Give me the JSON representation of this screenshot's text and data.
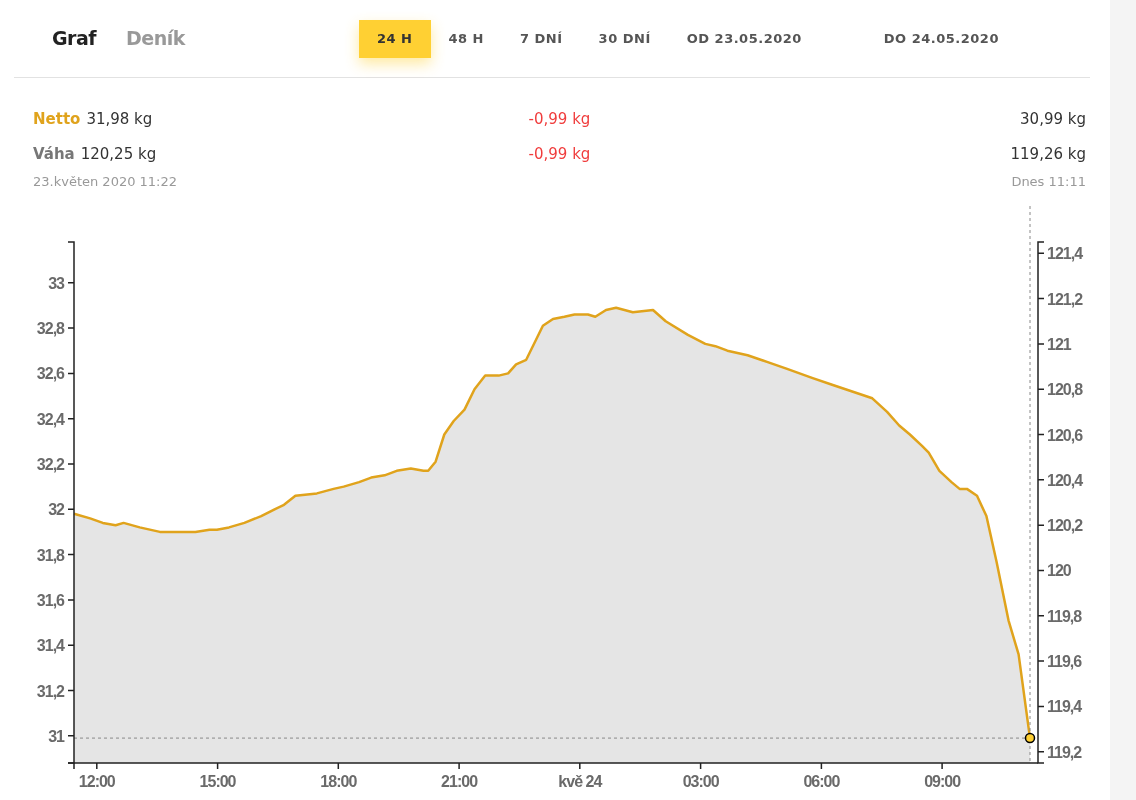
{
  "header": {
    "views": [
      {
        "label": "Graf",
        "selected": true
      },
      {
        "label": "Deník",
        "selected": false
      }
    ],
    "periods": [
      {
        "kind": "range",
        "label": "24 H",
        "selected": true
      },
      {
        "kind": "range",
        "label": "48 H",
        "selected": false
      },
      {
        "kind": "range",
        "label": "7 DNÍ",
        "selected": false
      },
      {
        "kind": "range",
        "label": "30 DNÍ",
        "selected": false
      },
      {
        "kind": "date",
        "label": "OD 23.05.2020",
        "selected": false
      },
      {
        "kind": "date",
        "label": "DO 24.05.2020",
        "selected": false
      }
    ]
  },
  "stats": {
    "rows": [
      {
        "kind": "netto",
        "label": "Netto",
        "start": "31,98 kg",
        "change": "-0,99 kg",
        "end": "30,99 kg"
      },
      {
        "kind": "weight",
        "label": "Váha",
        "start": "120,25 kg",
        "change": "-0,99 kg",
        "end": "119,26 kg"
      }
    ],
    "start_time": "23.květen 2020 11:22",
    "end_time": "Dnes 11:11"
  },
  "chart": {
    "chart_data": {
      "type": "area",
      "xlim": [
        "2020-05-23T11:26",
        "2020-05-24T11:11"
      ],
      "ylim": [
        30.88,
        33.18
      ],
      "y2lim": [
        119.15,
        121.45
      ],
      "xticks": [
        {
          "value": "2020-05-23T12:00",
          "label": "12:00"
        },
        {
          "value": "2020-05-23T15:00",
          "label": "15:00"
        },
        {
          "value": "2020-05-23T18:00",
          "label": "18:00"
        },
        {
          "value": "2020-05-23T21:00",
          "label": "21:00"
        },
        {
          "value": "2020-05-24T00:00",
          "label": "kvě 24"
        },
        {
          "value": "2020-05-24T03:00",
          "label": "03:00"
        },
        {
          "value": "2020-05-24T06:00",
          "label": "06:00"
        },
        {
          "value": "2020-05-24T09:00",
          "label": "09:00"
        }
      ],
      "yticks": [
        {
          "value": 31,
          "label": "31"
        },
        {
          "value": 31.2,
          "label": "31,2"
        },
        {
          "value": 31.4,
          "label": "31,4"
        },
        {
          "value": 31.6,
          "label": "31,6"
        },
        {
          "value": 31.8,
          "label": "31,8"
        },
        {
          "value": 32,
          "label": "32"
        },
        {
          "value": 32.2,
          "label": "32,2"
        },
        {
          "value": 32.4,
          "label": "32,4"
        },
        {
          "value": 32.6,
          "label": "32,6"
        },
        {
          "value": 32.8,
          "label": "32,8"
        },
        {
          "value": 33,
          "label": "33"
        }
      ],
      "y2ticks": [
        {
          "value": 119.2,
          "label": "119,2"
        },
        {
          "value": 119.4,
          "label": "119,4"
        },
        {
          "value": 119.6,
          "label": "119,6"
        },
        {
          "value": 119.8,
          "label": "119,8"
        },
        {
          "value": 120,
          "label": "120"
        },
        {
          "value": 120.2,
          "label": "120,2"
        },
        {
          "value": 120.4,
          "label": "120,4"
        },
        {
          "value": 120.6,
          "label": "120,6"
        },
        {
          "value": 120.8,
          "label": "120,8"
        },
        {
          "value": 121,
          "label": "121"
        },
        {
          "value": 121.2,
          "label": "121,2"
        },
        {
          "value": 121.4,
          "label": "121,4"
        }
      ],
      "x": [
        "2020-05-23T11:26",
        "2020-05-23T11:50",
        "2020-05-23T12:09",
        "2020-05-23T12:28",
        "2020-05-23T12:40",
        "2020-05-23T13:04",
        "2020-05-23T13:34",
        "2020-05-23T14:03",
        "2020-05-23T14:27",
        "2020-05-23T14:48",
        "2020-05-23T14:59",
        "2020-05-23T15:17",
        "2020-05-23T15:40",
        "2020-05-23T16:05",
        "2020-05-23T16:25",
        "2020-05-23T16:39",
        "2020-05-23T16:56",
        "2020-05-23T17:28",
        "2020-05-23T17:53",
        "2020-05-23T18:08",
        "2020-05-23T18:31",
        "2020-05-23T18:49",
        "2020-05-23T19:09",
        "2020-05-23T19:27",
        "2020-05-23T19:48",
        "2020-05-23T20:07",
        "2020-05-23T20:14",
        "2020-05-23T20:25",
        "2020-05-23T20:38",
        "2020-05-23T20:52",
        "2020-05-23T21:08",
        "2020-05-23T21:23",
        "2020-05-23T21:39",
        "2020-05-23T21:59",
        "2020-05-23T22:13",
        "2020-05-23T22:25",
        "2020-05-23T22:40",
        "2020-05-23T23:05",
        "2020-05-23T23:20",
        "2020-05-23T23:37",
        "2020-05-23T23:52",
        "2020-05-24T00:12",
        "2020-05-24T00:23",
        "2020-05-24T00:39",
        "2020-05-24T00:54",
        "2020-05-24T01:19",
        "2020-05-24T01:49",
        "2020-05-24T02:08",
        "2020-05-24T02:41",
        "2020-05-24T03:07",
        "2020-05-24T03:22",
        "2020-05-24T03:40",
        "2020-05-24T04:10",
        "2020-05-24T04:40",
        "2020-05-24T05:09",
        "2020-05-24T05:46",
        "2020-05-24T06:16",
        "2020-05-24T06:46",
        "2020-05-24T07:16",
        "2020-05-24T07:38",
        "2020-05-24T07:56",
        "2020-05-24T08:12",
        "2020-05-24T08:30",
        "2020-05-24T08:40",
        "2020-05-24T08:56",
        "2020-05-24T09:14",
        "2020-05-24T09:26",
        "2020-05-24T09:37",
        "2020-05-24T09:52",
        "2020-05-24T10:06",
        "2020-05-24T10:21",
        "2020-05-24T10:39",
        "2020-05-24T10:54",
        "2020-05-24T11:11"
      ],
      "series": [
        {
          "color": "#e0a31c",
          "values": [
            31.98,
            31.96,
            31.94,
            31.93,
            31.94,
            31.92,
            31.9,
            31.9,
            31.9,
            31.91,
            31.91,
            31.92,
            31.94,
            31.97,
            32.0,
            32.02,
            32.06,
            32.07,
            32.09,
            32.1,
            32.12,
            32.14,
            32.15,
            32.17,
            32.18,
            32.17,
            32.17,
            32.21,
            32.33,
            32.39,
            32.44,
            32.53,
            32.59,
            32.59,
            32.6,
            32.64,
            32.66,
            32.81,
            32.84,
            32.85,
            32.86,
            32.86,
            32.85,
            32.88,
            32.89,
            32.87,
            32.88,
            32.83,
            32.77,
            32.73,
            32.72,
            32.7,
            32.68,
            32.65,
            32.62,
            32.58,
            32.55,
            32.52,
            32.49,
            32.43,
            32.37,
            32.33,
            32.28,
            32.25,
            32.17,
            32.12,
            32.09,
            32.09,
            32.06,
            31.97,
            31.77,
            31.51,
            31.36,
            30.99
          ]
        }
      ],
      "ref_lines": [
        {
          "axis": "y",
          "value": 30.99
        },
        {
          "axis": "x",
          "value": "2020-05-24T11:11"
        }
      ]
    }
  }
}
